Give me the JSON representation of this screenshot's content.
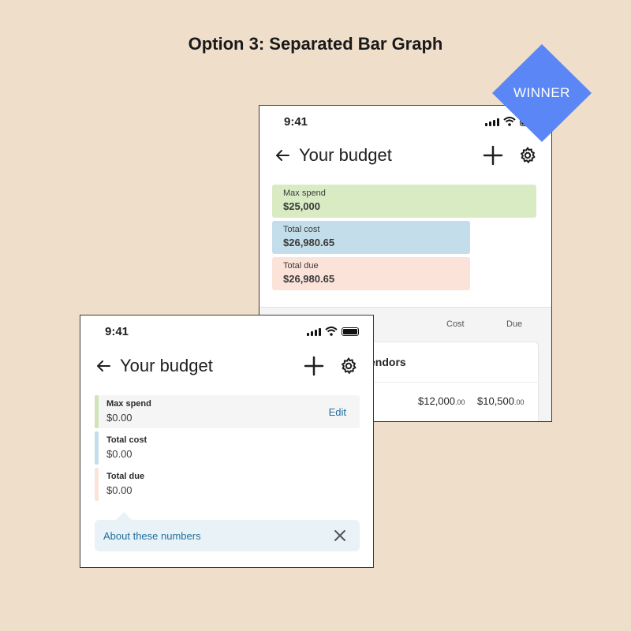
{
  "page": {
    "title": "Option 3: Separated Bar Graph"
  },
  "badge": {
    "label": "WINNER",
    "color": "#5b86f5"
  },
  "back_phone": {
    "status": {
      "time": "9:41"
    },
    "nav": {
      "title": "Your budget"
    },
    "bars": [
      {
        "label": "Max spend",
        "value": "$25,000",
        "color": "#d9ebc3"
      },
      {
        "label": "Total cost",
        "value": "$26,980.65",
        "color": "#c3deea"
      },
      {
        "label": "Total due",
        "value": "$26,980.65",
        "color": "#fbe3d9"
      }
    ],
    "table": {
      "col_cost": "Cost",
      "col_due": "Due",
      "vendor_title": "endors",
      "cost_main": "$12,000",
      "cost_cents": ".00",
      "due_main": "$10,500",
      "due_cents": ".00"
    }
  },
  "front_phone": {
    "status": {
      "time": "9:41"
    },
    "nav": {
      "title": "Your budget"
    },
    "rows": [
      {
        "label": "Max spend",
        "value": "$0.00",
        "color": "#cfe4b7",
        "action": "Edit"
      },
      {
        "label": "Total cost",
        "value": "$0.00",
        "color": "#c3deea"
      },
      {
        "label": "Total due",
        "value": "$0.00",
        "color": "#fbe3d9"
      }
    ],
    "about": {
      "label": "About these numbers"
    }
  }
}
